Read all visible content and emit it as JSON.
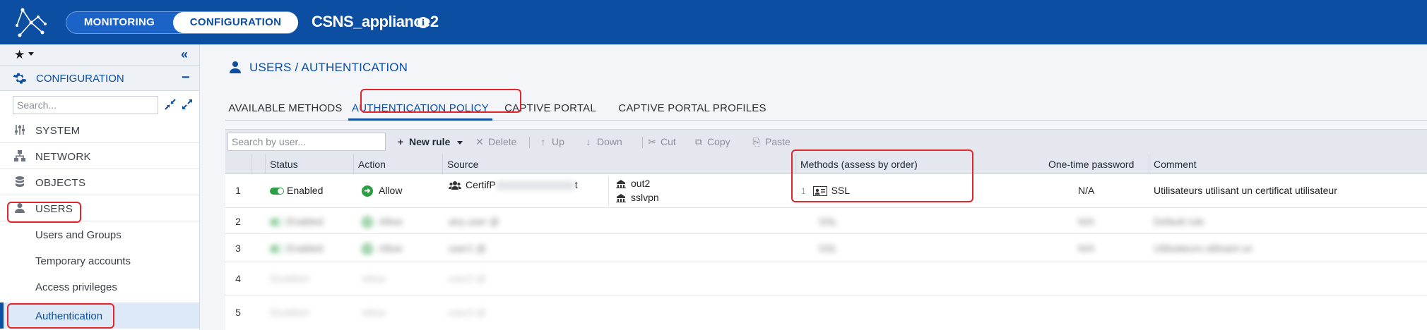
{
  "topbar": {
    "mode_monitoring": "MONITORING",
    "mode_configuration": "CONFIGURATION",
    "appliance_name": "CSNS_appliance2",
    "info_glyph": "i"
  },
  "sidebar": {
    "favorites_glyph": "★",
    "collapse_glyph": "«",
    "section_label": "CONFIGURATION",
    "section_toggle": "−",
    "search_placeholder": "Search...",
    "items": [
      {
        "label": "SYSTEM",
        "icon": "sliders-icon"
      },
      {
        "label": "NETWORK",
        "icon": "network-icon"
      },
      {
        "label": "OBJECTS",
        "icon": "database-icon"
      },
      {
        "label": "USERS",
        "icon": "user-icon"
      }
    ],
    "subitems": [
      {
        "label": "Users and Groups"
      },
      {
        "label": "Temporary accounts"
      },
      {
        "label": "Access privileges"
      },
      {
        "label": "Authentication",
        "active": true
      }
    ]
  },
  "main": {
    "page_title": "USERS / AUTHENTICATION",
    "tabs": [
      {
        "label": "AVAILABLE METHODS"
      },
      {
        "label": "AUTHENTICATION POLICY",
        "active": true
      },
      {
        "label": "CAPTIVE PORTAL"
      },
      {
        "label": "CAPTIVE PORTAL PROFILES"
      }
    ],
    "toolbar": {
      "search_placeholder": "Search by user...",
      "new_rule": "New rule",
      "delete": "Delete",
      "up": "Up",
      "down": "Down",
      "cut": "Cut",
      "copy": "Copy",
      "paste": "Paste"
    },
    "columns": {
      "status": "Status",
      "action": "Action",
      "source": "Source",
      "methods": "Methods (assess by order)",
      "otp": "One-time password",
      "comment": "Comment"
    },
    "rows": [
      {
        "num": "1",
        "status": "Enabled",
        "action": "Allow",
        "source": "CertifP",
        "source_suffix": "t",
        "interfaces": [
          "out2",
          "sslvpn"
        ],
        "method_index": "1",
        "method": "SSL",
        "otp": "N/A",
        "comment": "Utilisateurs utilisant un certificat utilisateur"
      },
      {
        "num": "2",
        "status": "Enabled",
        "action": "Allow",
        "source": "any user @",
        "method": "SSL",
        "otp": "N/A",
        "comment": "Default rule"
      },
      {
        "num": "3",
        "status": "Enabled",
        "action": "Allow",
        "source": "user1 @",
        "method": "SSL",
        "otp": "N/A",
        "comment": "Utilisateurs utilisant un"
      },
      {
        "num": "4",
        "status": "Disabled",
        "action": "Allow",
        "source": "user2 @",
        "method": "",
        "otp": "",
        "comment": ""
      },
      {
        "num": "5",
        "status": "Disabled",
        "action": "Allow",
        "source": "user3 @",
        "method": "",
        "otp": "",
        "comment": ""
      }
    ]
  },
  "colors": {
    "brand_blue": "#0b4ea2",
    "enabled_green": "#2c9f45",
    "highlight_red": "#e0262a"
  }
}
